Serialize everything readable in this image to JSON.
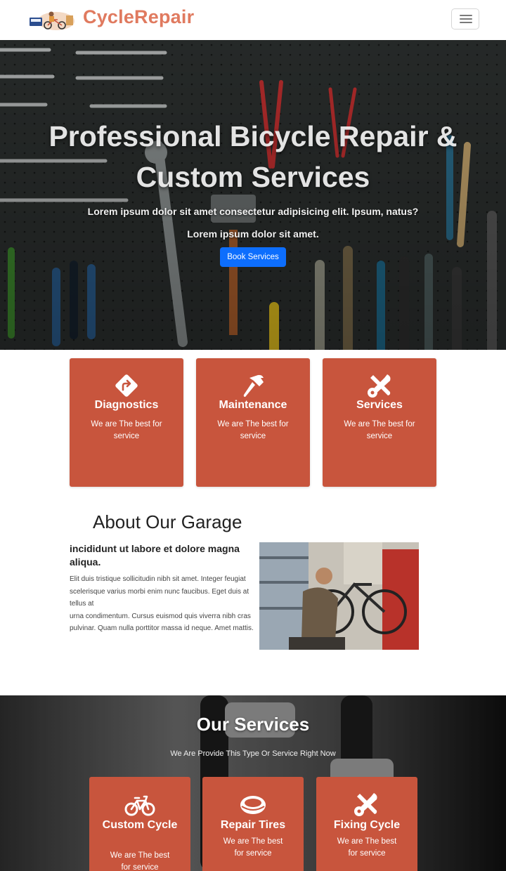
{
  "navbar": {
    "brand": "CycleRepair",
    "logo_icon": "bike-repair-logo-icon",
    "menu_icon": "hamburger-menu-icon"
  },
  "hero": {
    "title": "Professional Bicycle Repair & Custom Services",
    "subtitle": "Lorem ipsum dolor sit amet consectetur adipisicing elit. Ipsum, natus? Lorem ipsum dolor sit amet.",
    "button_label": "Book Services"
  },
  "features": [
    {
      "icon": "direction-sign-icon",
      "title": "Diagnostics",
      "text": "We are The best for service"
    },
    {
      "icon": "hammer-icon",
      "title": "Maintenance",
      "text": "We are The best for service"
    },
    {
      "icon": "tools-icon",
      "title": "Services",
      "text": "We are The best for service"
    }
  ],
  "about": {
    "title": "About Our Garage",
    "subtitle": "incididunt ut labore et dolore magna aliqua.",
    "paragraph_lines": [
      "Elit duis tristique sollicitudin nibh sit amet. Integer feugiat",
      "scelerisque varius morbi enim nunc faucibus. Eget duis at tellus at",
      "urna condimentum. Cursus euismod quis viverra nibh cras",
      "pulvinar. Quam nulla porttitor massa id neque. Amet mattis."
    ]
  },
  "services": {
    "title": "Our Services",
    "subtitle": "We Are Provide This Type Or Service Right Now",
    "cards": [
      {
        "icon": "bicycle-icon",
        "title": "Custom Cycle",
        "text": "We are The best for service"
      },
      {
        "icon": "tire-icon",
        "title": "Repair Tires",
        "text": "We are The best for service"
      },
      {
        "icon": "tools-icon",
        "title": "Fixing Cycle",
        "text": "We are The best for service"
      }
    ]
  },
  "colors": {
    "brand": "#e07a5f",
    "card": "#c8553d",
    "button": "#0d6efd"
  }
}
